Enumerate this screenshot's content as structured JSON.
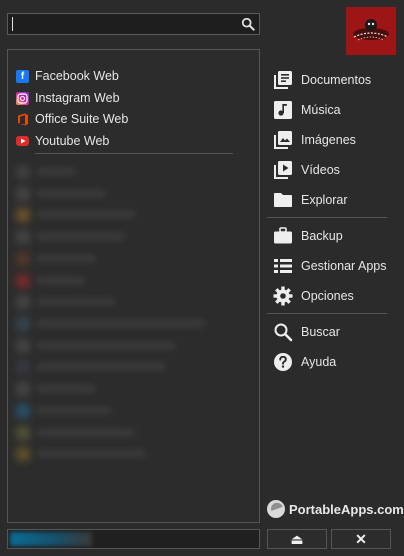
{
  "search": {
    "value": "",
    "placeholder": ""
  },
  "user_avatar": {
    "icon": "user-avatar-image",
    "bg_color": "#9e1515"
  },
  "pinned_apps": [
    {
      "label": "Facebook Web",
      "icon": "facebook-icon",
      "color": "#1877f2"
    },
    {
      "label": "Instagram Web",
      "icon": "instagram-icon",
      "color": "#d6249f"
    },
    {
      "label": "Office Suite Web",
      "icon": "office-icon",
      "color": "#e3480c"
    },
    {
      "label": "Youtube Web",
      "icon": "youtube-icon",
      "color": "#e02b2b"
    }
  ],
  "menu": {
    "documentos": "Documentos",
    "musica": "Música",
    "imagenes": "Imágenes",
    "videos": "Vídeos",
    "explorar": "Explorar",
    "backup": "Backup",
    "gestionar": "Gestionar Apps",
    "opciones": "Opciones",
    "buscar": "Buscar",
    "ayuda": "Ayuda"
  },
  "brand": "PortableApps.com",
  "progress": {
    "fraction": 0.33
  },
  "buttons": {
    "eject": "⏏",
    "close": "✕"
  }
}
